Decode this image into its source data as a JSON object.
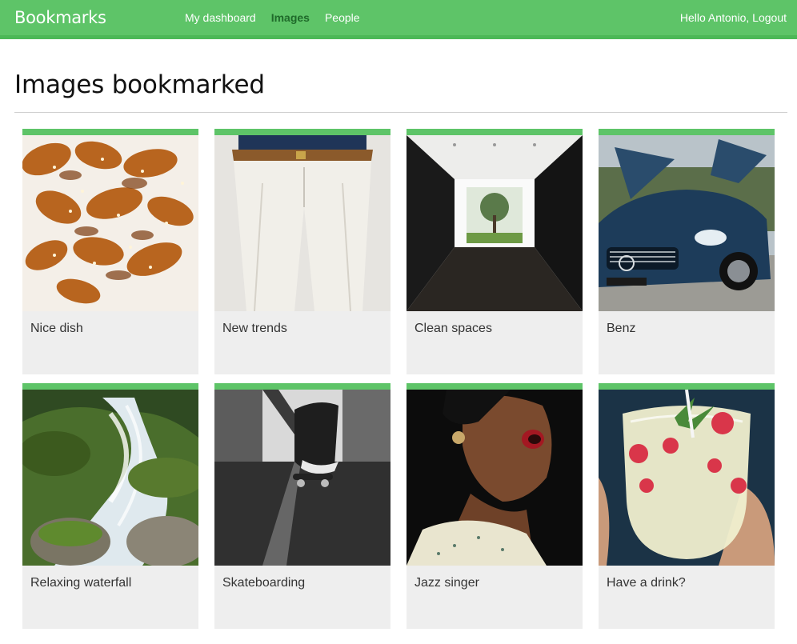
{
  "header": {
    "logo": "Bookmarks",
    "menu": [
      {
        "label": "My dashboard",
        "active": false
      },
      {
        "label": "Images",
        "active": true
      },
      {
        "label": "People",
        "active": false
      }
    ],
    "greeting": "Hello Antonio,",
    "logout": "Logout"
  },
  "page": {
    "title": "Images bookmarked"
  },
  "images": [
    {
      "title": "Nice dish"
    },
    {
      "title": "New trends"
    },
    {
      "title": "Clean spaces"
    },
    {
      "title": "Benz"
    },
    {
      "title": "Relaxing waterfall"
    },
    {
      "title": "Skateboarding"
    },
    {
      "title": "Jazz singer"
    },
    {
      "title": "Have a drink?"
    }
  ],
  "colors": {
    "header": "#5ec468",
    "active_menu": "#1f6a2a",
    "card_background": "#eeeeee"
  }
}
